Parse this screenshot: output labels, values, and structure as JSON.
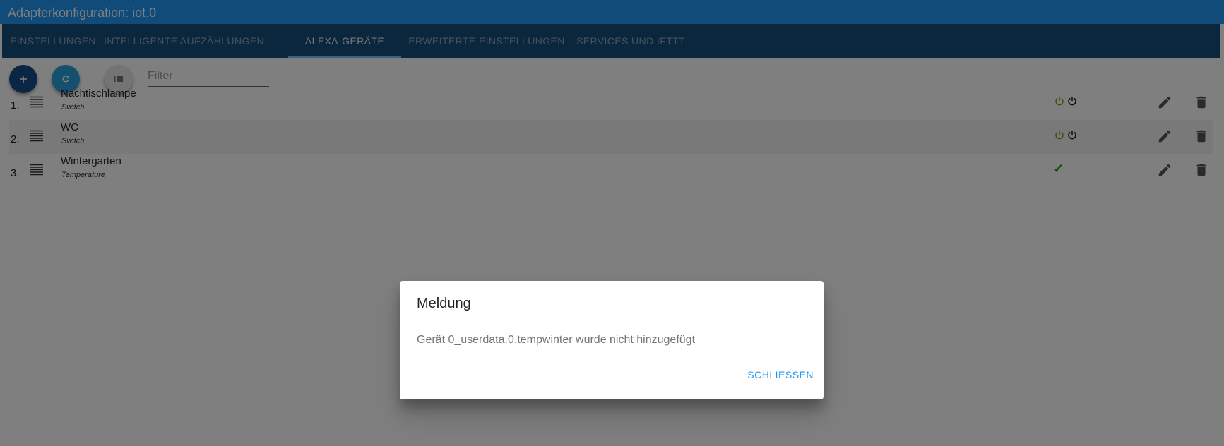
{
  "window": {
    "title": "Adapterkonfiguration: iot.0"
  },
  "tabs": [
    {
      "label": "EINSTELLUNGEN"
    },
    {
      "label": "INTELLIGENTE AUFZÄHLUNGEN"
    },
    {
      "label": "ALEXA-GERÄTE",
      "active": true
    },
    {
      "label": "ERWEITERTE EINSTELLUNGEN"
    },
    {
      "label": "SERVICES UND IFTTT"
    }
  ],
  "toolbar": {
    "add_icon": "plus-icon",
    "refresh_icon": "refresh-icon",
    "list_icon": "list-icon",
    "filter_placeholder": "Filter"
  },
  "devices": [
    {
      "num": "1.",
      "name": "Nachtischlampe",
      "type": "Switch",
      "state_icons": [
        "power-icon-green",
        "power-icon-dark"
      ]
    },
    {
      "num": "2.",
      "name": "WC",
      "type": "Switch",
      "state_icons": [
        "power-icon-green",
        "power-icon-dark"
      ]
    },
    {
      "num": "3.",
      "name": "Wintergarten",
      "type": "Temperature",
      "state_icons": [
        "thermometer-icon-green"
      ]
    }
  ],
  "dialog": {
    "title": "Meldung",
    "message": "Gerät 0_userdata.0.tempwinter wurde nicht hinzugefügt",
    "close_label": "SCHLIESSEN"
  },
  "colors": {
    "titlebar": "#2196f3",
    "tabbar": "#164f7c",
    "fab_add": "#174a88",
    "fab_refresh": "#2ba0dd",
    "power_green": "#8ea51e",
    "thermo_green": "#3a9a1a",
    "dialog_action": "#2196f3"
  }
}
